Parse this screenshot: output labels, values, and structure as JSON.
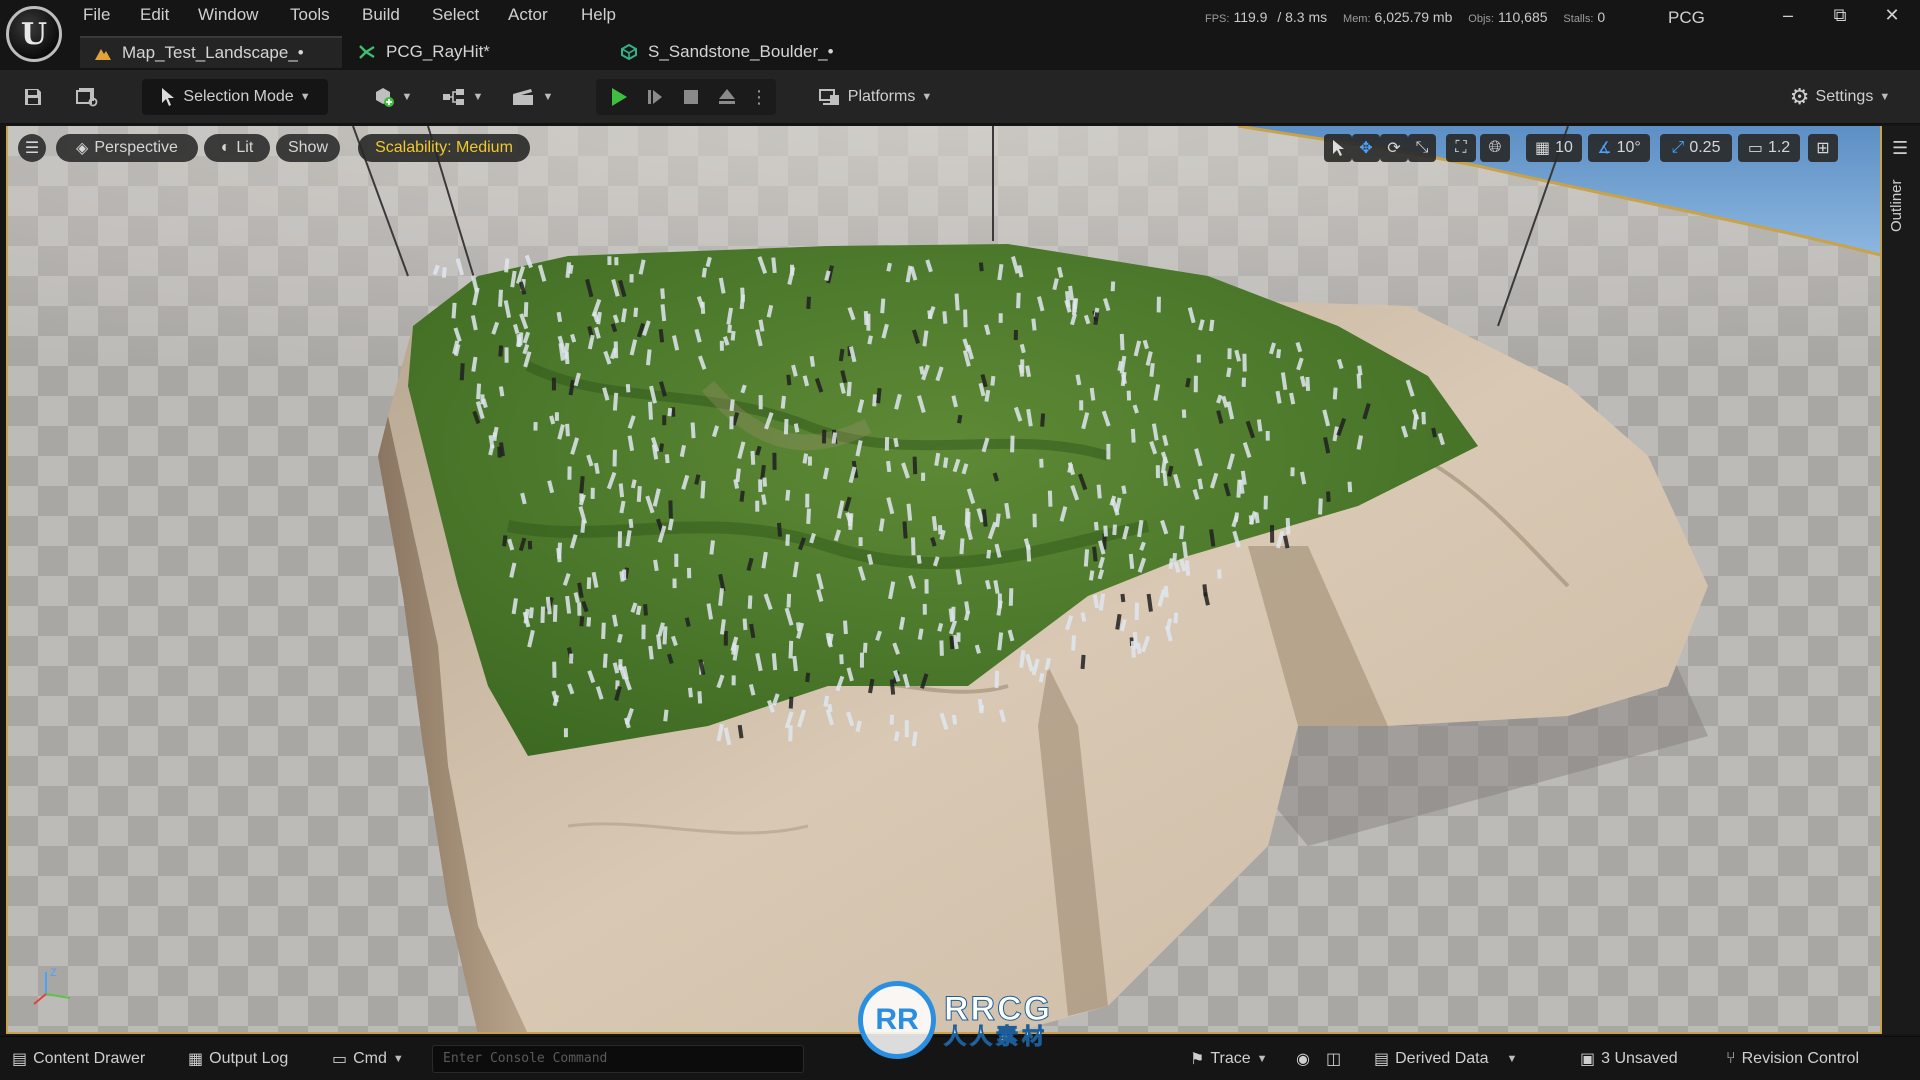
{
  "menu": [
    "File",
    "Edit",
    "Window",
    "Tools",
    "Build",
    "Select",
    "Actor",
    "Help"
  ],
  "stats": {
    "fps_label": "FPS:",
    "fps": "119.9",
    "ms": "/ 8.3 ms",
    "mem_label": "Mem:",
    "mem": "6,025.79 mb",
    "objs_label": "Objs:",
    "objs": "110,685",
    "stalls_label": "Stalls:",
    "stalls": "0"
  },
  "project": "PCG",
  "window_buttons": {
    "minimize": "–",
    "restore": "⧉",
    "close": "✕"
  },
  "tabs": [
    {
      "label": "Map_Test_Landscape_•",
      "icon": "level-icon"
    },
    {
      "label": "PCG_RayHit*",
      "icon": "pcg-graph-icon"
    },
    {
      "label": "S_Sandstone_Boulder_•",
      "icon": "static-mesh-icon"
    }
  ],
  "toolbar": {
    "selection_mode": "Selection Mode",
    "platforms": "Platforms",
    "settings": "Settings"
  },
  "viewport": {
    "perspective": "Perspective",
    "lit": "Lit",
    "show": "Show",
    "scalability": "Scalability: Medium",
    "grid_snap": "10",
    "rotation_snap": "10°",
    "scale_snap": "0.25",
    "camera_speed": "1.2",
    "outliner": "Outliner"
  },
  "statusbar": {
    "content_drawer": "Content Drawer",
    "output_log": "Output Log",
    "cmd": "Cmd",
    "console_placeholder": "Enter Console Command",
    "trace": "Trace",
    "derived_data": "Derived Data",
    "unsaved": "3 Unsaved",
    "revision_control": "Revision Control"
  },
  "watermark": {
    "logo": "RR",
    "top": "RRCG",
    "bottom": "人人素材"
  },
  "colors": {
    "accent_play": "#3fbf3f",
    "scalability_text": "#f0c830",
    "viewport_border": "#c9a24a",
    "snap_blue": "#4aa3ff"
  }
}
